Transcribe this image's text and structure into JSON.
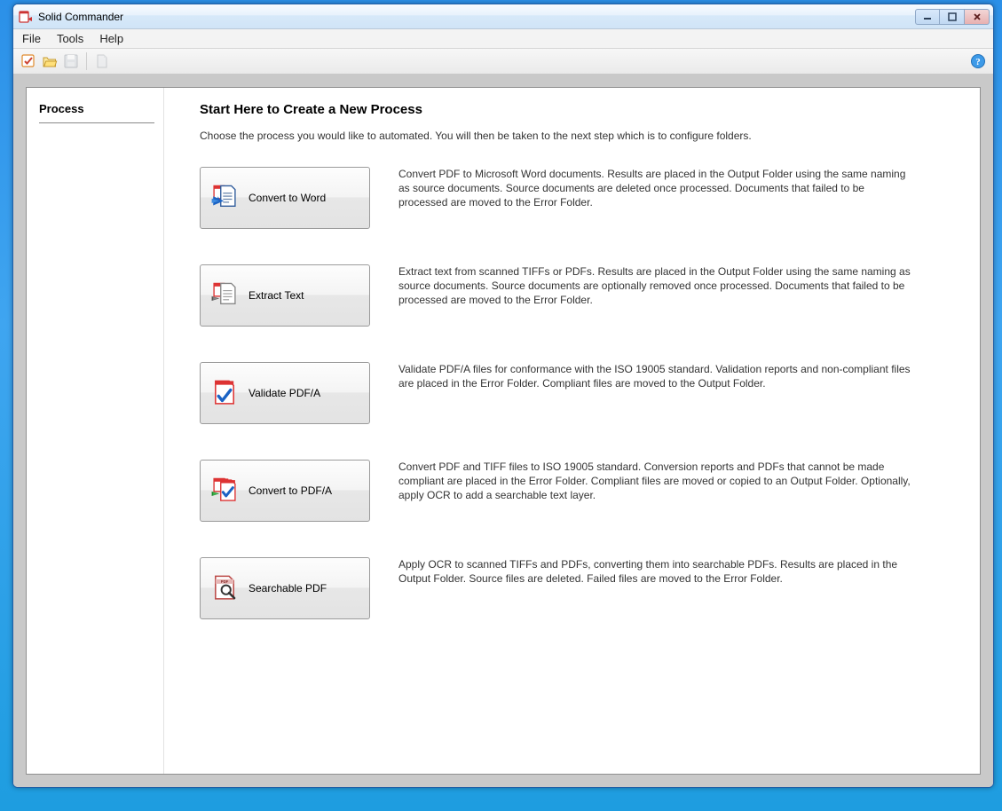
{
  "titlebar": {
    "title": "Solid Commander"
  },
  "menu": {
    "file": "File",
    "tools": "Tools",
    "help": "Help"
  },
  "sidebar": {
    "process": "Process"
  },
  "main": {
    "heading": "Start Here to Create a New Process",
    "intro": "Choose the process you would like to automated. You will then be taken to the next step which is to configure folders."
  },
  "processes": {
    "convert_word": {
      "label": "Convert to Word",
      "desc": "Convert PDF to Microsoft Word documents. Results are placed in the Output Folder using the same naming as source documents. Source documents are deleted once processed. Documents that failed to be processed are moved to the Error Folder."
    },
    "extract_text": {
      "label": "Extract Text",
      "desc": "Extract text from scanned TIFFs or PDFs. Results are placed in the Output Folder using the same naming as source documents. Source documents are optionally removed once processed. Documents that failed to be processed are moved to the Error Folder."
    },
    "validate_pdfa": {
      "label": "Validate PDF/A",
      "desc": "Validate PDF/A files for conformance with the ISO 19005 standard. Validation reports and non-compliant files are placed in the Error Folder. Compliant files are moved to the Output Folder."
    },
    "convert_pdfa": {
      "label": "Convert to PDF/A",
      "desc": "Convert PDF and TIFF files to ISO 19005 standard. Conversion reports and PDFs that cannot be made compliant are placed in the Error Folder. Compliant files are moved or copied to an Output Folder. Optionally, apply OCR to add a searchable text layer."
    },
    "searchable_pdf": {
      "label": "Searchable PDF",
      "desc": "Apply OCR to scanned TIFFs and PDFs, converting them into searchable PDFs. Results are placed in the Output Folder. Source files are deleted. Failed files are moved to the Error Folder."
    }
  }
}
